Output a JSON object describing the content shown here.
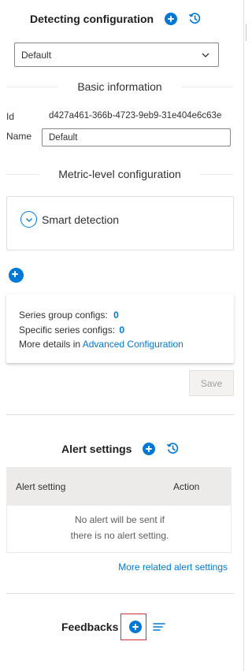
{
  "detecting": {
    "title": "Detecting configuration",
    "add_icon": "add-circle-icon",
    "history_icon": "history-icon",
    "selected_config": "Default"
  },
  "basic_info": {
    "heading": "Basic information",
    "id_label": "Id",
    "id_value": "d427a461-366b-4723-9eb9-31e404e6c63e",
    "name_label": "Name",
    "name_value": "Default"
  },
  "metric_level": {
    "heading": "Metric-level configuration",
    "smart_detection_label": "Smart detection",
    "summary": {
      "series_group_label": "Series group configs:",
      "series_group_count": "0",
      "specific_series_label": "Specific series configs:",
      "specific_series_count": "0",
      "details_prefix": "More details in",
      "details_link": "Advanced Configuration"
    },
    "save_label": "Save"
  },
  "alert_settings": {
    "title": "Alert settings",
    "columns": [
      "Alert setting",
      "Action"
    ],
    "empty_line1": "No alert will be sent if",
    "empty_line2": "there is no alert setting.",
    "more_link": "More related alert settings"
  },
  "feedbacks": {
    "title": "Feedbacks",
    "add_icon": "add-circle-icon",
    "list_icon": "list-icon"
  },
  "colors": {
    "accent": "#0078d4",
    "highlight": "#d13438"
  }
}
